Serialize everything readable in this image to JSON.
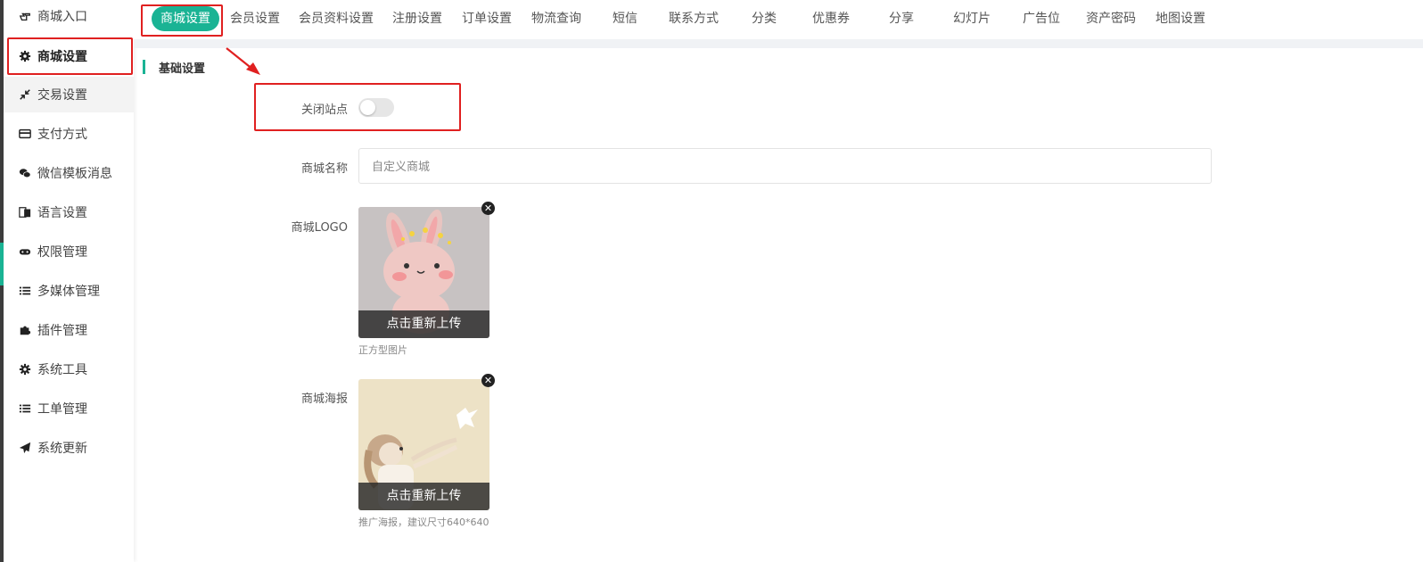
{
  "sidebar": {
    "items": [
      {
        "label": "商城入口",
        "icon": "hand-point-icon"
      },
      {
        "label": "商城设置",
        "icon": "gear-icon"
      },
      {
        "label": "交易设置",
        "icon": "compress-arrows-icon"
      },
      {
        "label": "支付方式",
        "icon": "credit-card-icon"
      },
      {
        "label": "微信模板消息",
        "icon": "wechat-icon"
      },
      {
        "label": "语言设置",
        "icon": "language-icon"
      },
      {
        "label": "权限管理",
        "icon": "gamepad-icon"
      },
      {
        "label": "多媒体管理",
        "icon": "list-icon"
      },
      {
        "label": "插件管理",
        "icon": "puzzle-icon"
      },
      {
        "label": "系统工具",
        "icon": "gear-icon"
      },
      {
        "label": "工单管理",
        "icon": "list-icon"
      },
      {
        "label": "系统更新",
        "icon": "paper-plane-icon"
      }
    ]
  },
  "tabs": [
    "商城设置",
    "会员设置",
    "会员资料设置",
    "注册设置",
    "订单设置",
    "物流查询",
    "短信",
    "联系方式",
    "分类",
    "优惠券",
    "分享",
    "幻灯片",
    "广告位",
    "资产密码",
    "地图设置"
  ],
  "section_title": "基础设置",
  "form": {
    "close_site_label": "关闭站点",
    "close_site_on": false,
    "shop_name_label": "商城名称",
    "shop_name_placeholder": "自定义商城",
    "logo_label": "商城LOGO",
    "logo_caption": "点击重新上传",
    "logo_hint": "正方型图片",
    "poster_label": "商城海报",
    "poster_caption": "点击重新上传",
    "poster_hint": "推广海报，建议尺寸640*640"
  },
  "colors": {
    "accent": "#1ab394",
    "highlight": "#e02020"
  }
}
